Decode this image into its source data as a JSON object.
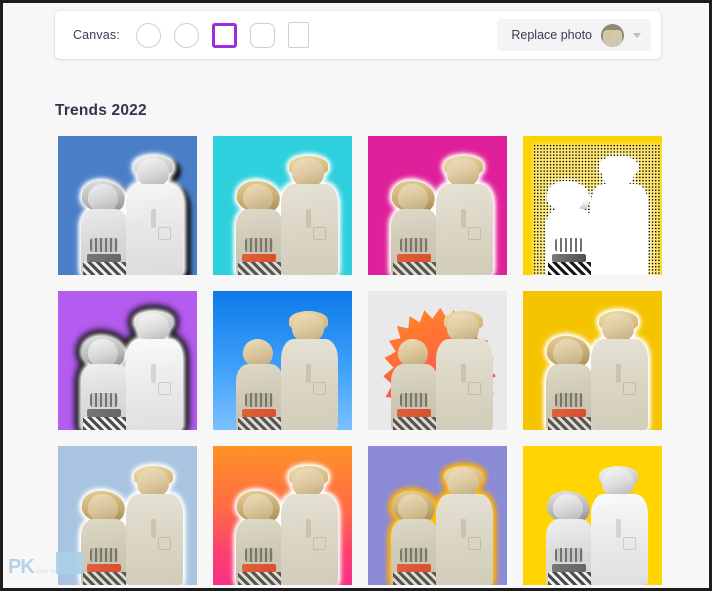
{
  "toolbar": {
    "canvas_label": "Canvas:",
    "shapes": [
      {
        "name": "canvas-shape-circle-1",
        "form": "circle",
        "selected": false
      },
      {
        "name": "canvas-shape-circle-2",
        "form": "circle",
        "selected": false
      },
      {
        "name": "canvas-shape-square",
        "form": "square",
        "selected": true
      },
      {
        "name": "canvas-shape-rounded",
        "form": "rounded",
        "selected": false
      },
      {
        "name": "canvas-shape-portrait",
        "form": "portrait",
        "selected": false
      }
    ],
    "selected_shape": "square",
    "replace_photo_label": "Replace photo",
    "replace_photo_thumb": "photo-thumbnail",
    "caret_icon": "chevron-down-icon",
    "accent_color": "#9b30d9"
  },
  "gallery": {
    "title": "Trends 2022",
    "thumbnails": [
      {
        "index": 1,
        "background": "#4a7fc8",
        "bg_type": "solid",
        "effect": "grayscale",
        "outline": "white-with-black-shadow",
        "classes": "gray sticker-white-shadow"
      },
      {
        "index": 2,
        "background": "#2ed0dd",
        "bg_type": "solid",
        "effect": "color",
        "outline": "white",
        "classes": "sticker-white"
      },
      {
        "index": 3,
        "background": "#e0209a",
        "bg_type": "solid",
        "effect": "color",
        "outline": "white",
        "classes": "sticker-white"
      },
      {
        "index": 4,
        "background": "#fcd200",
        "bg_type": "solid",
        "effect": "halftone",
        "outline": "white",
        "classes": "halftone"
      },
      {
        "index": 5,
        "background": "#b45cf0",
        "bg_type": "solid",
        "effect": "grayscale",
        "outline": "black",
        "classes": "gray sticker-black"
      },
      {
        "index": 6,
        "background": "linear-gradient(#0d7ae8 0%, #3ea0fb 55%, #7cc0ff 100%)",
        "bg_type": "gradient",
        "effect": "color",
        "outline": "none",
        "classes": "sticker-none"
      },
      {
        "index": 7,
        "background": "#e9e9ea",
        "bg_type": "solid",
        "effect": "color",
        "outline": "orange-pink-starburst",
        "classes": "sticker-none",
        "spikes": true
      },
      {
        "index": 8,
        "background": "#f5c400",
        "bg_type": "solid",
        "effect": "color",
        "outline": "white",
        "classes": "sticker-white"
      },
      {
        "index": 9,
        "background": "#a8c4e0",
        "bg_type": "solid",
        "effect": "color",
        "outline": "white",
        "classes": "sticker-white"
      },
      {
        "index": 10,
        "background": "linear-gradient(#ff9326 0%, #ff6a45 45%, #fb3f72 78%, #f92f84 100%)",
        "bg_type": "gradient",
        "effect": "color",
        "outline": "white",
        "classes": "sticker-white"
      },
      {
        "index": 11,
        "background": "#8b8bd8",
        "bg_type": "solid",
        "effect": "color",
        "outline": "yellow",
        "classes": "sticker-yellow"
      },
      {
        "index": 12,
        "background": "#ffd400",
        "bg_type": "solid",
        "effect": "grayscale",
        "outline": "none",
        "classes": "gray sticker-none"
      }
    ]
  },
  "watermark": {
    "text": "PK",
    "subtext": "com.tw"
  }
}
